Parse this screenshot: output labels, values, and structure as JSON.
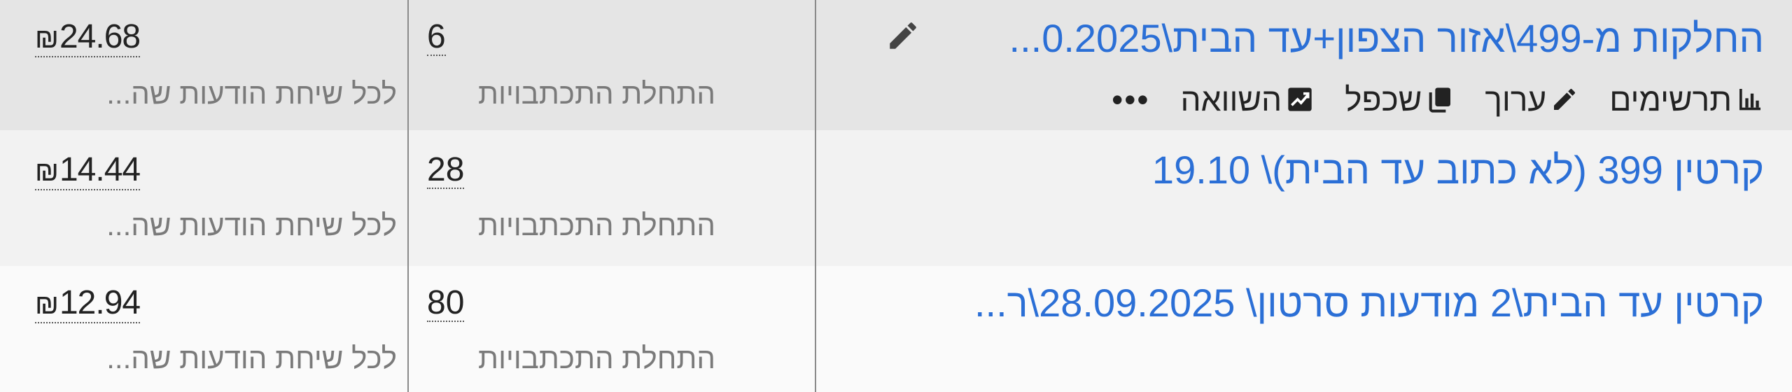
{
  "rows": [
    {
      "name": "החלקות מ-499\\אזור הצפון+עד הבית\\0.2025...",
      "count": "6",
      "count_label": "התחלת התכתבויות",
      "amount_symbol": "₪",
      "amount": "24.68",
      "amount_label": "לכל שיחת הודעות שה..."
    },
    {
      "name": "קרטין 399 (לא כתוב עד הבית)\\ 19.10",
      "count": "28",
      "count_label": "התחלת התכתבויות",
      "amount_symbol": "₪",
      "amount": "14.44",
      "amount_label": "לכל שיחת הודעות שה..."
    },
    {
      "name": "קרטין עד הבית\\2 מודעות סרטון\\ 28.09.2025\\ר...",
      "count": "80",
      "count_label": "התחלת התכתבויות",
      "amount_symbol": "₪",
      "amount": "12.94",
      "amount_label": "לכל שיחת הודעות שה..."
    }
  ],
  "actions": {
    "charts": "תרשימים",
    "edit": "ערוך",
    "duplicate": "שכפל",
    "compare": "השוואה",
    "more": "•••"
  },
  "icons": {
    "charts": "bar-chart-icon",
    "edit": "pencil-icon",
    "duplicate": "duplicate-icon",
    "compare": "compare-chart-icon",
    "name_edit": "pencil-icon"
  },
  "colors": {
    "link": "#2b6fd6",
    "header_row_bg": "#e5e5e5"
  }
}
